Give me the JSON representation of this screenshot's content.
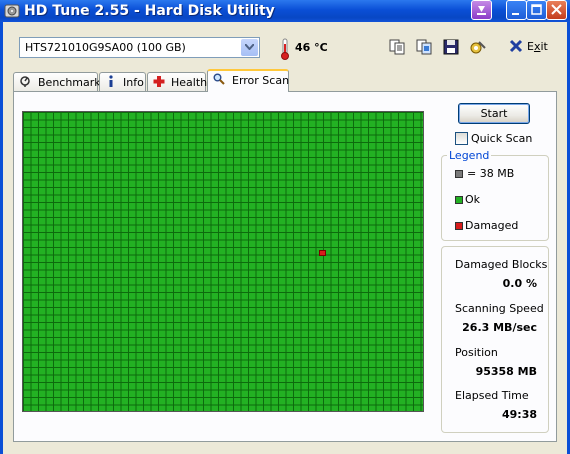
{
  "window": {
    "title": "HD Tune 2.55 - Hard Disk Utility"
  },
  "toolbar": {
    "drive": "HTS721010G9SA00 (100 GB)",
    "temperature": "46 °C",
    "exit_label": "Exit",
    "icons": [
      "copy-text-icon",
      "copy-screenshot-icon",
      "save-icon",
      "options-icon"
    ]
  },
  "tabs": [
    {
      "label": "Benchmark",
      "icon": "benchmark-icon"
    },
    {
      "label": "Info",
      "icon": "info-icon"
    },
    {
      "label": "Health",
      "icon": "health-icon"
    },
    {
      "label": "Error Scan",
      "icon": "magnifier-icon",
      "active": true
    }
  ],
  "scan": {
    "start_label": "Start",
    "quick_scan_label": "Quick Scan",
    "quick_scan_checked": false,
    "ok_color": "#23b123",
    "damaged_color": "#d81c1c"
  },
  "legend": {
    "title": "Legend",
    "block_size": "= 38 MB",
    "ok": "Ok",
    "damaged": "Damaged"
  },
  "stats": {
    "damaged_blocks_label": "Damaged Blocks",
    "damaged_blocks_value": "0.0 %",
    "scanning_speed_label": "Scanning Speed",
    "scanning_speed_value": "26.3 MB/sec",
    "position_label": "Position",
    "position_value": "95358 MB",
    "elapsed_label": "Elapsed Time",
    "elapsed_value": "49:38"
  }
}
